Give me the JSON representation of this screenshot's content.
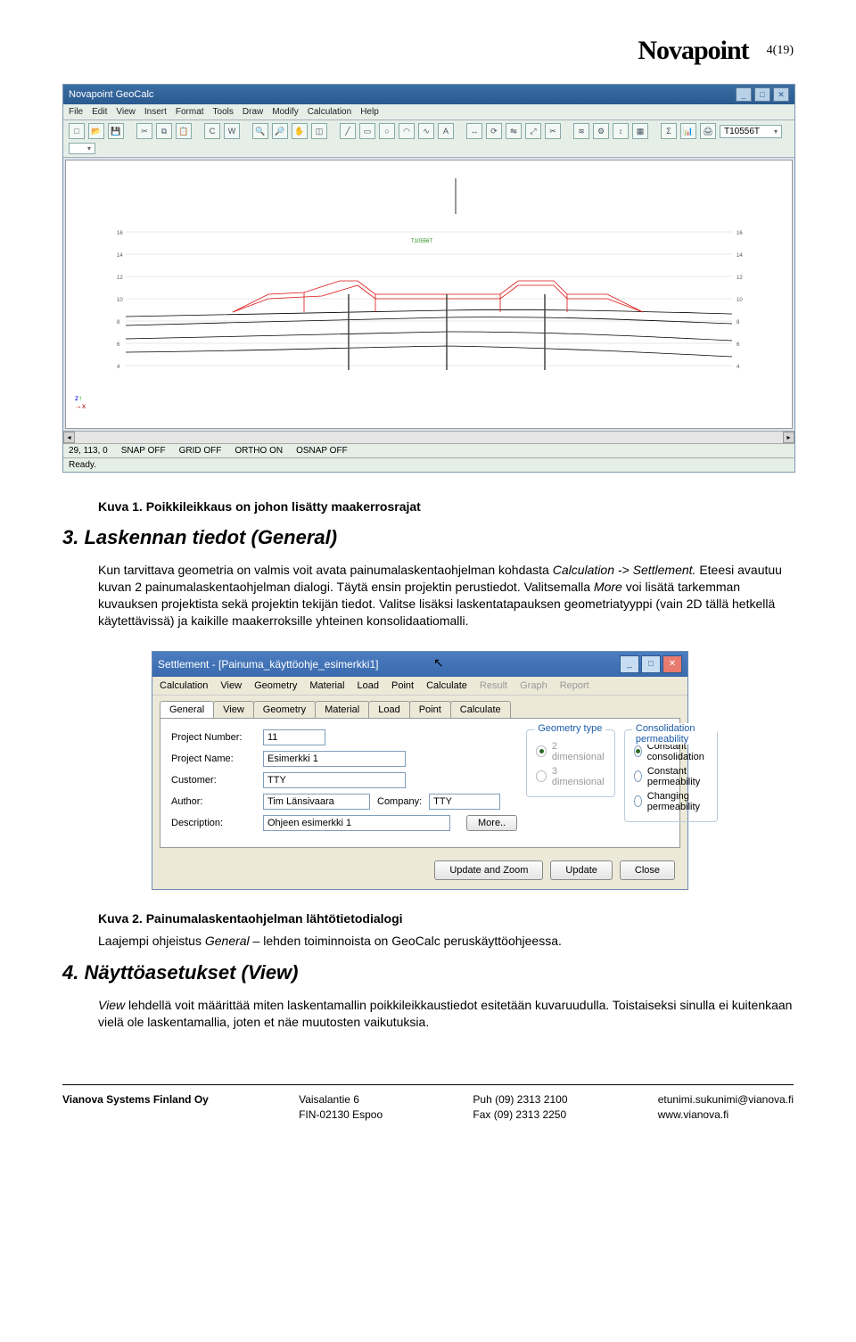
{
  "header": {
    "brand": "Novapoint",
    "pagenum": "4(19)"
  },
  "app": {
    "title": "Novapoint GeoCalc",
    "menus": [
      "File",
      "Edit",
      "View",
      "Insert",
      "Format",
      "Tools",
      "Draw",
      "Modify",
      "Calculation",
      "Help"
    ],
    "topLabel": "T10556T",
    "coords": "29, 113, 0",
    "snap": "SNAP OFF",
    "grid": "GRID OFF",
    "ortho": "ORTHO ON",
    "osnap": "OSNAP OFF",
    "ready": "Ready."
  },
  "caption1": "Kuva 1. Poikkileikkaus on johon lisätty maakerrosrajat",
  "h1": "3. Laskennan tiedot (General)",
  "p1a": "Kun tarvittava geometria on valmis voit avata painumalaskentaohjelman kohdasta ",
  "p1b": "Calculation -> Settlement.",
  "p1c": " Eteesi avautuu kuvan 2 painumalaskentaohjelman dialogi. Täytä ensin projektin perustiedot. Valitsemalla ",
  "p1d": "More",
  "p1e": " voi lisätä tarkemman kuvauksen projektista sekä projektin tekijän tiedot. Valitse lisäksi laskentatapauksen geometriatyyppi (vain 2D tällä hetkellä käytettävissä) ja kaikille maakerroksille yhteinen konsolidaatiomalli.",
  "dlg": {
    "title": "Settlement - [Painuma_käyttöohje_esimerkki1]",
    "menus": [
      "Calculation",
      "View",
      "Geometry",
      "Material",
      "Load",
      "Point",
      "Calculate"
    ],
    "menus_dis": [
      "Result",
      "Graph",
      "Report"
    ],
    "tabs": [
      "General",
      "View",
      "Geometry",
      "Material",
      "Load",
      "Point",
      "Calculate"
    ],
    "labels": {
      "projnum": "Project Number:",
      "projname": "Project Name:",
      "customer": "Customer:",
      "author": "Author:",
      "company": "Company:",
      "description": "Description:"
    },
    "values": {
      "projnum": "11",
      "projname": "Esimerkki 1",
      "customer": "TTY",
      "author": "Tim Länsivaara",
      "company": "TTY",
      "description": "Ohjeen esimerkki 1"
    },
    "geom_legend": "Geometry type",
    "geom2d": "2 dimensional",
    "geom3d": "3 dimensional",
    "cons_legend": "Consolidation permeability",
    "cons1": "Constant consolidation",
    "cons2": "Constant permeability",
    "cons3": "Changing permeability",
    "more": "More..",
    "btn_uz": "Update and Zoom",
    "btn_u": "Update",
    "btn_c": "Close"
  },
  "caption2": "Kuva 2. Painumalaskentaohjelman lähtötietodialogi",
  "p2a": "Laajempi ohjeistus ",
  "p2b": "General",
  "p2c": " – lehden toiminnoista on GeoCalc peruskäyttöohjeessa.",
  "h2": "4. Näyttöasetukset (View)",
  "p3a": "View",
  "p3b": "  lehdellä voit määrittää miten laskentamallin poikkileikkaustiedot esitetään kuvaruudulla. Toistaiseksi sinulla ei kuitenkaan vielä ole laskentamallia, joten et näe muutosten vaikutuksia.",
  "footer": {
    "c1a": "Vianova Systems Finland Oy",
    "c2a": "Vaisalantie 6",
    "c2b": "FIN-02130 Espoo",
    "c3a": "Puh  (09) 2313 2100",
    "c3b": "Fax  (09) 2313 2250",
    "c4a": "etunimi.sukunimi@vianova.fi",
    "c4b": "www.vianova.fi"
  }
}
